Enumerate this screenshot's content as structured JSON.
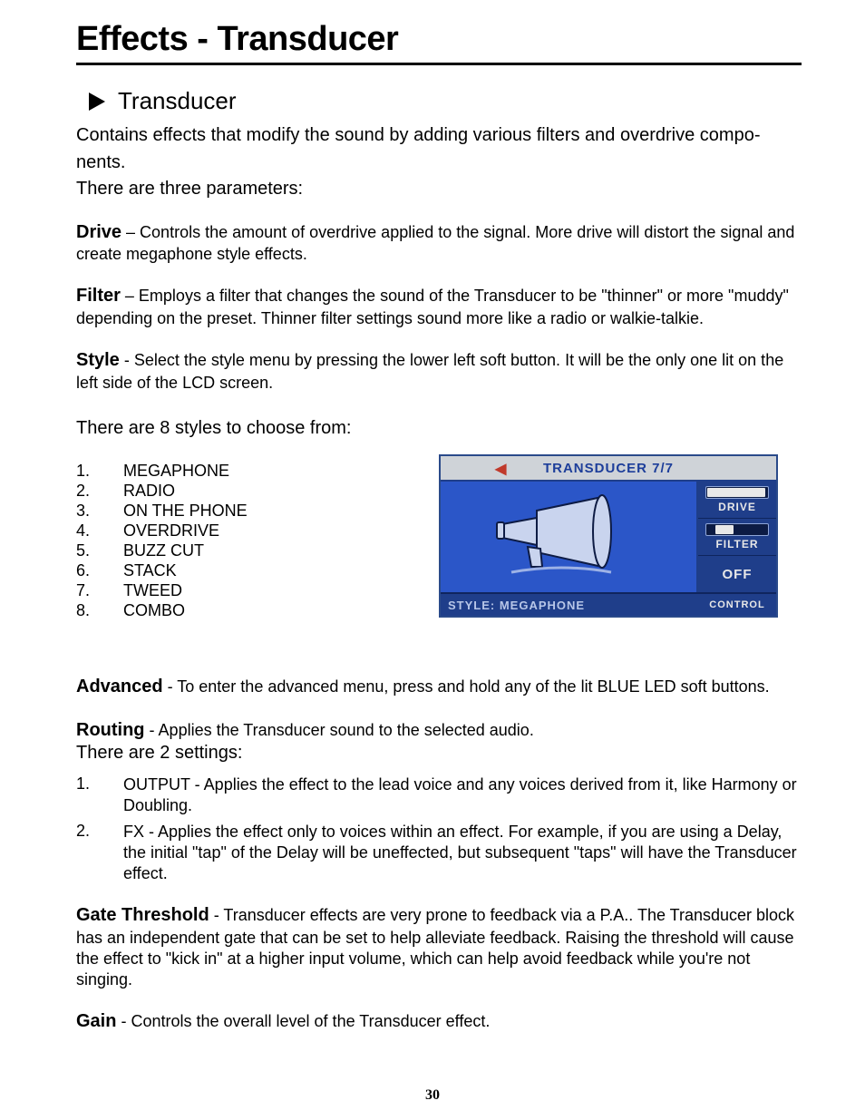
{
  "page": {
    "title": "Effects - Transducer",
    "number": "30"
  },
  "section": {
    "heading": "Transducer",
    "intro_l1": "Contains effects that modify the sound by adding various filters and overdrive compo-",
    "intro_l2": "nents.",
    "intro_l3": "There are three parameters:"
  },
  "params": {
    "drive": {
      "label": "Drive",
      "sep": " – ",
      "text": "Controls the amount of overdrive applied to the signal. More drive will distort the signal and create megaphone style effects."
    },
    "filter": {
      "label": "Filter",
      "sep": " – ",
      "text": "Employs a filter that changes the sound of the Transducer to be \"thinner\" or more \"muddy\" depending on the preset. Thinner filter settings sound more like a radio or walkie-talkie."
    },
    "style": {
      "label": "Style",
      "sep": " - ",
      "text": "Select the style menu by pressing the lower left soft button. It will be the only one lit on the left side of the LCD screen."
    }
  },
  "styles_intro": "There are 8 styles to choose from:",
  "styles": [
    {
      "n": "1.",
      "v": "MEGAPHONE"
    },
    {
      "n": "2.",
      "v": "RADIO"
    },
    {
      "n": "3.",
      "v": "ON THE PHONE"
    },
    {
      "n": "4.",
      "v": "OVERDRIVE"
    },
    {
      "n": "5.",
      "v": "BUZZ CUT"
    },
    {
      "n": "6.",
      "v": "STACK"
    },
    {
      "n": "7.",
      "v": "TWEED"
    },
    {
      "n": "8.",
      "v": "COMBO"
    }
  ],
  "lcd": {
    "title": "TRANSDUCER  7/7",
    "footer_left": "STYLE: MEGAPHONE",
    "footer_right": "CONTROL",
    "side": {
      "drive": "DRIVE",
      "filter": "FILTER",
      "off": "OFF"
    }
  },
  "advanced": {
    "label": "Advanced",
    "sep": " - ",
    "text": "To enter the advanced menu, press and hold any of the lit BLUE LED soft buttons."
  },
  "routing": {
    "label": "Routing",
    "sep": " - ",
    "text": "Applies the Transducer sound to the selected audio.",
    "sub": "There are 2 settings:"
  },
  "routing_items": [
    {
      "n": "1.",
      "v": "OUTPUT - Applies the effect to the lead voice and any voices derived from it, like Harmony or Doubling."
    },
    {
      "n": "2.",
      "v": "FX - Applies the effect only to voices within an effect. For example, if you are using a Delay, the initial \"tap\" of the Delay will be uneffected, but subsequent \"taps\" will have the Transducer effect."
    }
  ],
  "gate": {
    "label": "Gate Threshold",
    "sep": " - ",
    "text": "Transducer effects are very prone to feedback via a P.A.. The Transducer block has an independent gate that can be set to help alleviate feedback. Raising the threshold will cause the effect to \"kick in\" at a higher input volume, which can help avoid feedback while you're not singing."
  },
  "gain": {
    "label": "Gain",
    "sep": " - ",
    "text": "Controls the overall level of the Transducer effect."
  }
}
